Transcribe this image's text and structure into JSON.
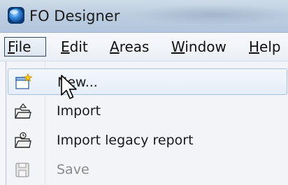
{
  "window": {
    "title": "FO Designer",
    "icon": "fo-designer-app-icon"
  },
  "menubar": {
    "items": [
      {
        "pre": "",
        "acc": "F",
        "post": "ile",
        "active": true
      },
      {
        "pre": "",
        "acc": "E",
        "post": "dit",
        "active": false
      },
      {
        "pre": "",
        "acc": "A",
        "post": "reas",
        "active": false
      },
      {
        "pre": "",
        "acc": "W",
        "post": "indow",
        "active": false
      },
      {
        "pre": "",
        "acc": "H",
        "post": "elp",
        "active": false
      }
    ]
  },
  "file_menu": {
    "items": [
      {
        "label": "New...",
        "icon": "new-document-icon",
        "enabled": true,
        "highlighted": true
      },
      {
        "label": "Import",
        "icon": "import-folder-icon",
        "enabled": true,
        "highlighted": false
      },
      {
        "label": "Import legacy report",
        "icon": "import-legacy-icon",
        "enabled": true,
        "highlighted": false
      },
      {
        "label": "Save",
        "icon": "save-disk-icon",
        "enabled": false,
        "highlighted": false
      }
    ]
  },
  "colors": {
    "titlebar": "#bccde0",
    "menu_bg": "#f2f4f7",
    "highlight_border": "#a8c0df",
    "active_menu_border": "#33475e",
    "disabled_text": "#8a8a8a"
  }
}
